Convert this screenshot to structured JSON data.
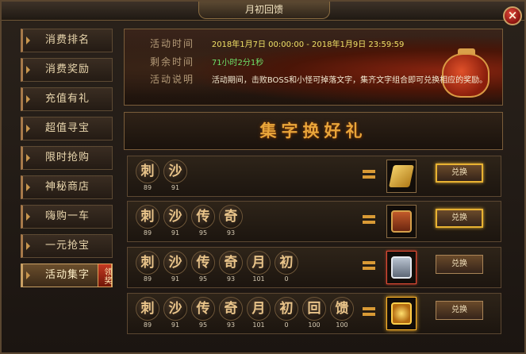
{
  "window": {
    "title": "月初回馈",
    "close_label": "×"
  },
  "sidebar": {
    "items": [
      {
        "label": "消费排名",
        "active": false
      },
      {
        "label": "消费奖励",
        "active": false
      },
      {
        "label": "充值有礼",
        "active": false
      },
      {
        "label": "超值寻宝",
        "active": false
      },
      {
        "label": "限时抢购",
        "active": false
      },
      {
        "label": "神秘商店",
        "active": false
      },
      {
        "label": "嗨购一车",
        "active": false
      },
      {
        "label": "一元抢宝",
        "active": false
      },
      {
        "label": "活动集字",
        "active": true,
        "badge": "领奖"
      }
    ]
  },
  "banner": {
    "time_label": "活动时间",
    "time_value": "2018年1月7日 00:00:00 - 2018年1月9日 23:59:59",
    "remain_label": "剩余时间",
    "remain_value": "71小时2分1秒",
    "desc_label": "活动说明",
    "desc_value": "活动期间，击败BOSS和小怪可掉落文字，集齐文字组合即可兑换相应的奖励。"
  },
  "section": {
    "title": "集字换好礼"
  },
  "rows": [
    {
      "chars": [
        {
          "c": "刺",
          "n": "89"
        },
        {
          "c": "沙",
          "n": "91"
        }
      ],
      "reward": "gold-bar-icon",
      "button": "兑换",
      "highlight": true
    },
    {
      "chars": [
        {
          "c": "刺",
          "n": "89"
        },
        {
          "c": "沙",
          "n": "91"
        },
        {
          "c": "传",
          "n": "95"
        },
        {
          "c": "奇",
          "n": "93"
        }
      ],
      "reward": "red-chest-icon",
      "button": "兑换",
      "highlight": true
    },
    {
      "chars": [
        {
          "c": "刺",
          "n": "89"
        },
        {
          "c": "沙",
          "n": "91"
        },
        {
          "c": "传",
          "n": "95"
        },
        {
          "c": "奇",
          "n": "93"
        },
        {
          "c": "月",
          "n": "101"
        },
        {
          "c": "初",
          "n": "0"
        }
      ],
      "reward": "silver-chest-icon",
      "button": "兑换",
      "highlight": false
    },
    {
      "chars": [
        {
          "c": "刺",
          "n": "89"
        },
        {
          "c": "沙",
          "n": "91"
        },
        {
          "c": "传",
          "n": "95"
        },
        {
          "c": "奇",
          "n": "93"
        },
        {
          "c": "月",
          "n": "101"
        },
        {
          "c": "初",
          "n": "0"
        },
        {
          "c": "回",
          "n": "100"
        },
        {
          "c": "馈",
          "n": "100"
        }
      ],
      "reward": "gold-chest-icon",
      "button": "兑换",
      "highlight": false
    }
  ]
}
